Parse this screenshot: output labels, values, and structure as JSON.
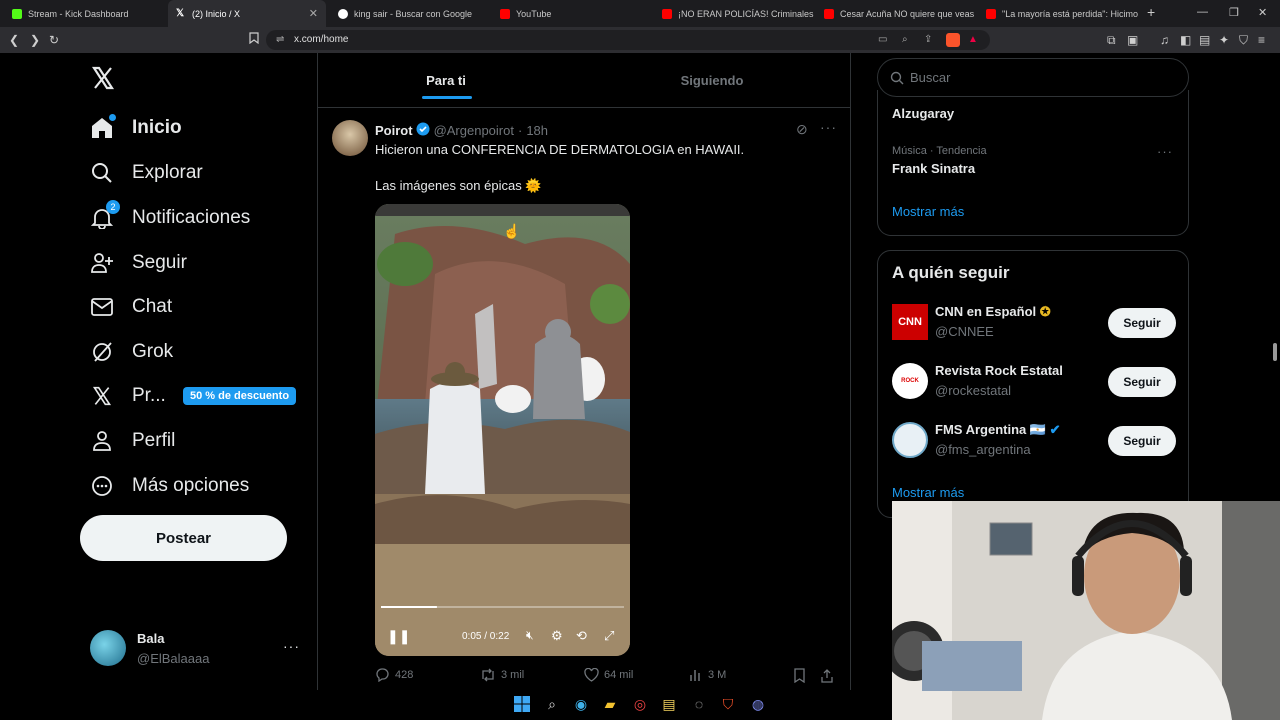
{
  "browser": {
    "tabs": [
      {
        "title": "Stream - Kick Dashboard",
        "color": "#53fc18"
      },
      {
        "title": "(2) Inicio / X",
        "color": "#ffffff"
      },
      {
        "title": "king sair - Buscar con Google",
        "color": "#4285f4"
      },
      {
        "title": "YouTube",
        "color": "#ff0000"
      },
      {
        "title": "¡NO ERAN POLICÍAS! Criminales se D",
        "color": "#ff0000"
      },
      {
        "title": "Cesar Acuña NO quiere que veas est",
        "color": "#ff0000"
      },
      {
        "title": "\"La mayoría está perdida\": Hicimos u",
        "color": "#ff0000"
      }
    ],
    "url": "x.com/home"
  },
  "sidebar": {
    "items": [
      {
        "label": "Inicio",
        "icon": "home-icon"
      },
      {
        "label": "Explorar",
        "icon": "search-icon"
      },
      {
        "label": "Notificaciones",
        "icon": "bell-icon",
        "badge": "2"
      },
      {
        "label": "Seguir",
        "icon": "add-person-icon"
      },
      {
        "label": "Chat",
        "icon": "mail-icon"
      },
      {
        "label": "Grok",
        "icon": "grok-icon"
      },
      {
        "label": "Pr...",
        "icon": "x-logo-icon"
      },
      {
        "label": "Perfil",
        "icon": "person-icon"
      },
      {
        "label": "Más opciones",
        "icon": "more-circle-icon"
      }
    ],
    "promo_badge": "50 % de descuento",
    "post_button": "Postear",
    "account": {
      "name": "Bala",
      "handle": "@ElBalaaaa"
    }
  },
  "feed": {
    "tabs": [
      "Para ti",
      "Siguiendo"
    ],
    "post": {
      "author": "Poirot",
      "handle": "@Argenpoirot",
      "time": "18h",
      "line1": "Hicieron una CONFERENCIA DE DERMATOLOGIA en HAWAII.",
      "line2": "Las imágenes son épicas 🌞",
      "video_time": "0:05 / 0:22",
      "video_progress": 0.23,
      "replies": "428",
      "reposts": "3 mil",
      "likes": "64 mil",
      "views": "3 M"
    }
  },
  "right": {
    "search_placeholder": "Buscar",
    "trend_top": "Alzugaray",
    "trend_meta": "Música · Tendencia",
    "trend_name": "Frank Sinatra",
    "show_more": "Mostrar más",
    "who_to_follow_title": "A quién seguir",
    "follow": [
      {
        "name": "CNN en Español",
        "handle": "@CNNEE",
        "button": "Seguir"
      },
      {
        "name": "Revista Rock Estatal",
        "handle": "@rockestatal",
        "button": "Seguir"
      },
      {
        "name": "FMS Argentina 🇦🇷",
        "handle": "@fms_argentina",
        "button": "Seguir"
      }
    ],
    "show_more_2": "Mostrar más"
  },
  "colors": {
    "accent": "#1d9bf0",
    "background": "#000000",
    "border": "#2f3336",
    "muted": "#71767b"
  }
}
